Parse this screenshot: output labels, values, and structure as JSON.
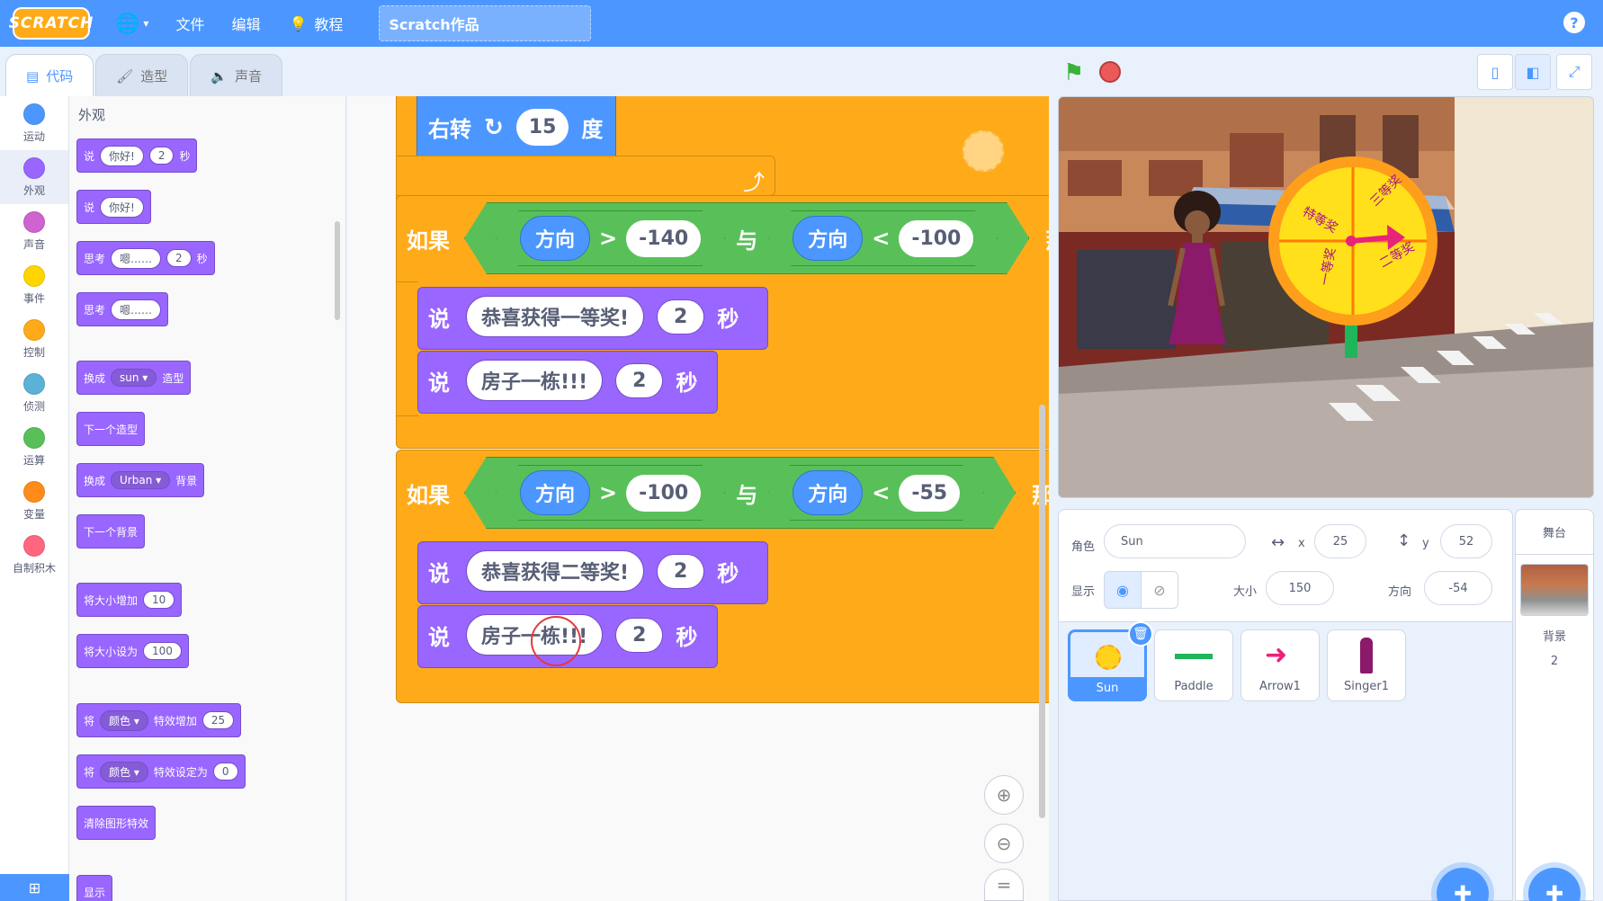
{
  "menu": {
    "logo": "SCRATCH",
    "file": "文件",
    "edit": "编辑",
    "tutorials": "教程",
    "project_title": "Scratch作品",
    "help": "?"
  },
  "tabs": [
    {
      "label": "代码",
      "icon": "code-icon",
      "active": true
    },
    {
      "label": "造型",
      "icon": "brush-icon",
      "active": false
    },
    {
      "label": "声音",
      "icon": "speaker-icon",
      "active": false
    }
  ],
  "categories": [
    {
      "label": "运动",
      "color": "#4c97ff"
    },
    {
      "label": "外观",
      "color": "#9966ff"
    },
    {
      "label": "声音",
      "color": "#cf63cf"
    },
    {
      "label": "事件",
      "color": "#ffd500"
    },
    {
      "label": "控制",
      "color": "#ffab19"
    },
    {
      "label": "侦测",
      "color": "#5cb1d6"
    },
    {
      "label": "运算",
      "color": "#59c059"
    },
    {
      "label": "变量",
      "color": "#ff8c1a"
    },
    {
      "label": "自制积木",
      "color": "#ff6680"
    }
  ],
  "palette": {
    "section": "外观",
    "say_secs": {
      "a": "说",
      "msg": "你好!",
      "secs": "2",
      "unit": "秒"
    },
    "say": {
      "a": "说",
      "msg": "你好!"
    },
    "think_secs": {
      "a": "思考",
      "msg": "嗯……",
      "secs": "2",
      "unit": "秒"
    },
    "think": {
      "a": "思考",
      "msg": "嗯……"
    },
    "switch_costume": {
      "a": "换成",
      "val": "sun",
      "b": "造型"
    },
    "next_costume": "下一个造型",
    "switch_backdrop": {
      "a": "换成",
      "val": "Urban",
      "b": "背景"
    },
    "next_backdrop": "下一个背景",
    "change_size": {
      "a": "将大小增加",
      "val": "10"
    },
    "set_size": {
      "a": "将大小设为",
      "val": "100"
    },
    "change_effect": {
      "a": "将",
      "val": "颜色",
      "b": "特效增加",
      "num": "25"
    },
    "set_effect": {
      "a": "将",
      "val": "颜色",
      "b": "特效设定为",
      "num": "0"
    },
    "clear_effects": "清除图形特效",
    "show": "显示"
  },
  "script": {
    "turn": {
      "label": "右转",
      "deg": "15",
      "unit": "度"
    },
    "if1": {
      "if": "如果",
      "left": {
        "reporter": "方向",
        "op": ">",
        "value": "-140"
      },
      "and": "与",
      "right": {
        "reporter": "方向",
        "op": "<",
        "value": "-100"
      },
      "then": "那么",
      "say1": {
        "label": "说",
        "msg": "恭喜获得一等奖!",
        "secs": "2",
        "unit": "秒"
      },
      "say2": {
        "label": "说",
        "msg": "房子一栋!!!",
        "secs": "2",
        "unit": "秒"
      }
    },
    "if2": {
      "if": "如果",
      "left": {
        "reporter": "方向",
        "op": ">",
        "value": "-100"
      },
      "and": "与",
      "right": {
        "reporter": "方向",
        "op": "<",
        "value": "-55"
      },
      "then": "那么",
      "say1": {
        "label": "说",
        "msg": "恭喜获得二等奖!",
        "secs": "2",
        "unit": "秒"
      },
      "say2": {
        "label": "说",
        "msg": "房子一栋!!!",
        "secs": "2",
        "unit": "秒"
      }
    },
    "zoom_reset": "="
  },
  "wheel_labels": [
    "三等奖",
    "二等奖",
    "一等奖",
    "特等奖"
  ],
  "sprite_info": {
    "sprite_label": "角色",
    "sprite_name": "Sun",
    "x_label": "x",
    "x": "25",
    "y_label": "y",
    "y": "52",
    "show_label": "显示",
    "size_label": "大小",
    "size": "150",
    "direction_label": "方向",
    "direction": "-54"
  },
  "sprites": [
    {
      "name": "Sun",
      "selected": true
    },
    {
      "name": "Paddle",
      "selected": false
    },
    {
      "name": "Arrow1",
      "selected": false
    },
    {
      "name": "Singer1",
      "selected": false
    }
  ],
  "stage_panel": {
    "title": "舞台",
    "backdrop_label": "背景",
    "backdrop_count": "2"
  }
}
